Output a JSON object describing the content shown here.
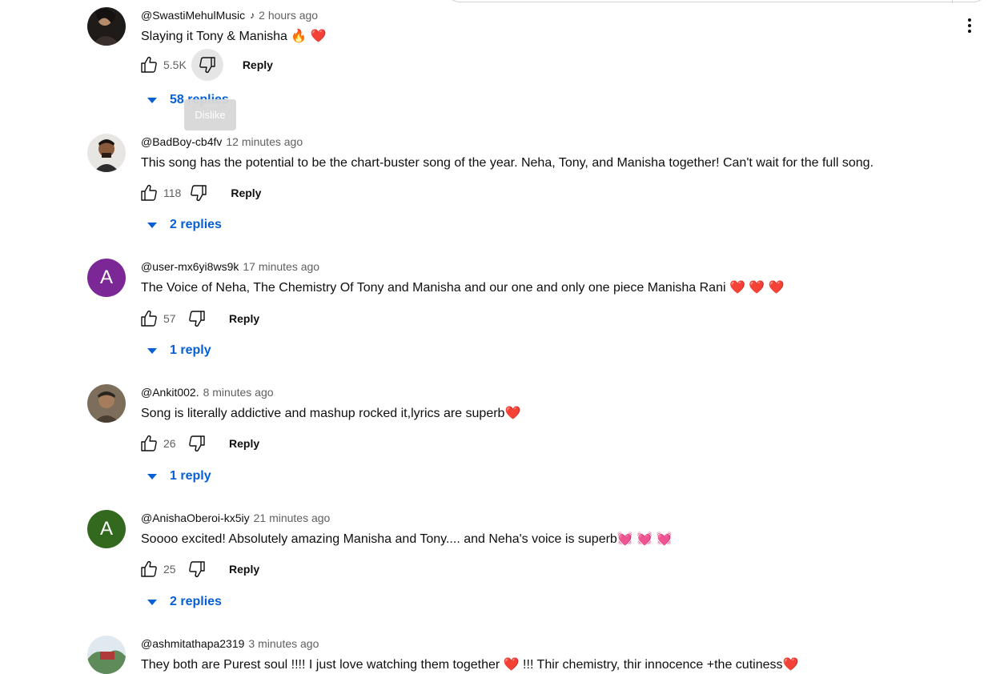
{
  "header": {
    "more_icon": "more-vert-icon"
  },
  "tooltip": {
    "text": "Dislike"
  },
  "reply_label": "Reply",
  "comments": [
    {
      "author": "@SwastiMehulMusic",
      "music_note": "♪",
      "time": "2 hours ago",
      "text": "Slaying it Tony & Manisha 🔥 ❤️",
      "likes": "5.5K",
      "replies": "58 replies",
      "avatar": {
        "kind": "photo",
        "color": "#2a2522"
      }
    },
    {
      "author": "@BadBoy-cb4fv",
      "time": "12 minutes ago",
      "text": "This song has the potential to be the chart-buster song of the year. Neha, Tony, and Manisha together! Can't wait for the full song.",
      "likes": "118",
      "replies": "2 replies",
      "avatar": {
        "kind": "photo",
        "color": "#5a3e2e"
      }
    },
    {
      "author": "@user-mx6yi8ws9k",
      "time": "17 minutes ago",
      "text": "The Voice of Neha, The Chemistry Of Tony and Manisha and our one and only one piece Manisha Rani ❤️ ❤️ ❤️",
      "likes": "57",
      "replies": "1 reply",
      "avatar": {
        "kind": "letter",
        "letter": "A",
        "color": "#7b2796"
      }
    },
    {
      "author": "@Ankit002.",
      "time": "8 minutes ago",
      "text": "Song is literally addictive and mashup rocked it,lyrics are superb❤️",
      "likes": "26",
      "replies": "1 reply",
      "avatar": {
        "kind": "photo",
        "color": "#6b5a48"
      }
    },
    {
      "author": "@AnishaOberoi-kx5iy",
      "time": "21 minutes ago",
      "text": "Soooo excited! Absolutely amazing Manisha and Tony.... and Neha's voice is superb💓 💓 💓",
      "likes": "25",
      "replies": "2 replies",
      "avatar": {
        "kind": "letter",
        "letter": "A",
        "color": "#33691e"
      }
    },
    {
      "author": "@ashmitathapa2319",
      "time": "3 minutes ago",
      "text": "They both are Purest soul !!!! I just love watching them together ❤️ !!! Thir chemistry, thir innocence +the cutiness❤️",
      "likes": "",
      "replies": "",
      "avatar": {
        "kind": "photo",
        "color": "#8fa88a"
      }
    }
  ]
}
